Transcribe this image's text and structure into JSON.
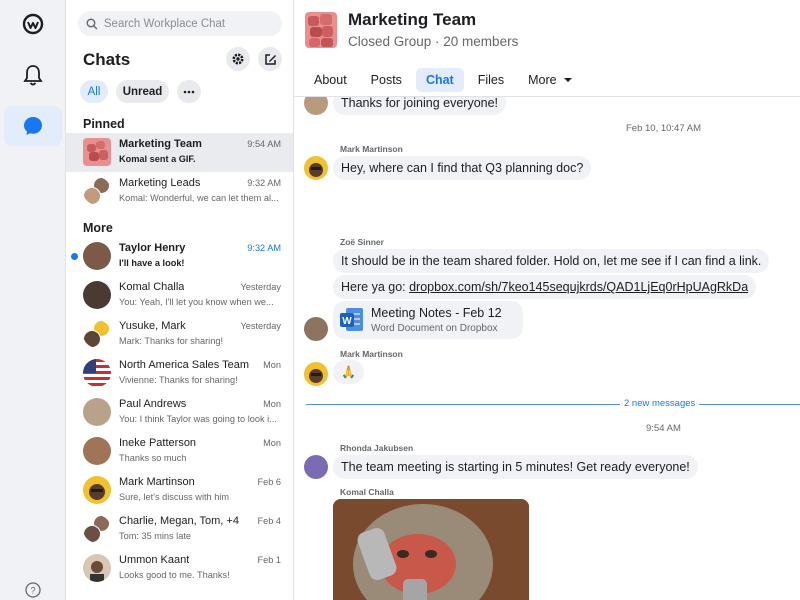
{
  "search": {
    "placeholder": "Search Workplace Chat"
  },
  "chats": {
    "title": "Chats",
    "filters": [
      "All",
      "Unread"
    ],
    "pinned_label": "Pinned",
    "more_label": "More",
    "pinned": [
      {
        "name": "Marketing Team",
        "preview": "Komal sent a GIF.",
        "time": "9:54 AM"
      },
      {
        "name": "Marketing Leads",
        "preview": "Komal: Wonderful, we can let them al...",
        "time": "9:32 AM"
      }
    ],
    "more": [
      {
        "name": "Taylor Henry",
        "preview": "I'll have a look!",
        "time": "9:32 AM"
      },
      {
        "name": "Komal Challa",
        "preview": "You: Yeah, I'll let you know when we...",
        "time": "Yesterday"
      },
      {
        "name": "Yusuke, Mark",
        "preview": "Mark: Thanks for sharing!",
        "time": "Yesterday"
      },
      {
        "name": "North America Sales Team",
        "preview": "Vivienne: Thanks for sharing!",
        "time": "Mon"
      },
      {
        "name": "Paul Andrews",
        "preview": "You: I think Taylor was going to look i...",
        "time": "Mon"
      },
      {
        "name": "Ineke Patterson",
        "preview": "Thanks so much",
        "time": "Mon"
      },
      {
        "name": "Mark Martinson",
        "preview": "Sure, let's discuss with him",
        "time": "Feb 6"
      },
      {
        "name": "Charlie, Megan, Tom, +4",
        "preview": "Tom: 35 mins late",
        "time": "Feb 4"
      },
      {
        "name": "Ummon Kaant",
        "preview": "Looks good to me. Thanks!",
        "time": "Feb 1"
      }
    ]
  },
  "conversation": {
    "title": "Marketing Team",
    "subtitle": "Closed Group · 20 members",
    "tabs": [
      "About",
      "Posts",
      "Chat",
      "Files",
      "More"
    ],
    "first_bubble": "Thanks for joining everyone!",
    "stamp1": "Feb 10, 10:47 AM",
    "mark_name": "Mark Martinson",
    "mark_msg": "Hey, where can I find that Q3 planning doc?",
    "zoe_name": "Zoë Sinner",
    "zoe_msg1": "It should be in the team shared folder. Hold on, let me see if I can find a link.",
    "zoe_msg2_prefix": "Here ya go: ",
    "zoe_link": "dropbox.com/sh/7keo145sequjkrds/QAD1LjEq0rHpUAgRkDa",
    "attachment": {
      "title": "Meeting Notes - Feb 12",
      "subtitle": "Word Document on Dropbox"
    },
    "mark_name2": "Mark Martinson",
    "mark_reaction": "🙏",
    "new_messages": "2 new messages",
    "stamp2": "9:54 AM",
    "rhonda_name": "Rhonda Jakubsen",
    "rhonda_msg": "The team meeting is starting in 5 minutes! Get ready everyone!",
    "komal_name": "Komal Challa"
  },
  "colors": {
    "accent": "#1877f2",
    "unread": "#1877f2",
    "rail": "#f0f2f5"
  }
}
